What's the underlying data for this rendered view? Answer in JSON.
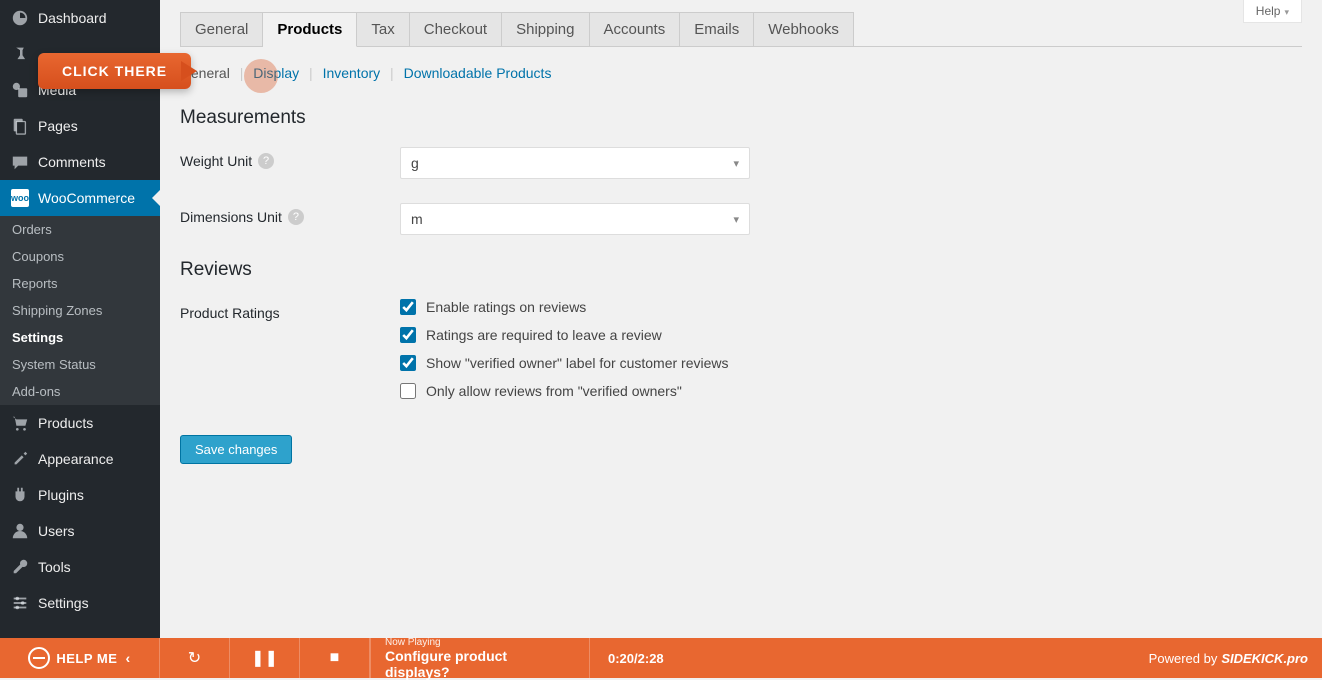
{
  "help_tab": "Help",
  "callout": "CLICK THERE",
  "sidebar": {
    "items": [
      {
        "label": "Dashboard"
      },
      {
        "label": ""
      },
      {
        "label": "Media"
      },
      {
        "label": "Pages"
      },
      {
        "label": "Comments"
      },
      {
        "label": "WooCommerce"
      },
      {
        "label": "Products"
      },
      {
        "label": "Appearance"
      },
      {
        "label": "Plugins"
      },
      {
        "label": "Users"
      },
      {
        "label": "Tools"
      },
      {
        "label": "Settings"
      }
    ],
    "woo_sub": [
      {
        "label": "Orders"
      },
      {
        "label": "Coupons"
      },
      {
        "label": "Reports"
      },
      {
        "label": "Shipping Zones"
      },
      {
        "label": "Settings"
      },
      {
        "label": "System Status"
      },
      {
        "label": "Add-ons"
      }
    ]
  },
  "tabs": [
    {
      "label": "General"
    },
    {
      "label": "Products"
    },
    {
      "label": "Tax"
    },
    {
      "label": "Checkout"
    },
    {
      "label": "Shipping"
    },
    {
      "label": "Accounts"
    },
    {
      "label": "Emails"
    },
    {
      "label": "Webhooks"
    }
  ],
  "subtabs": {
    "general": "General",
    "display": "Display",
    "inventory": "Inventory",
    "downloadable": "Downloadable Products"
  },
  "sections": {
    "measurements": {
      "heading": "Measurements",
      "weight_label": "Weight Unit",
      "weight_value": "g",
      "dimensions_label": "Dimensions Unit",
      "dimensions_value": "m"
    },
    "reviews": {
      "heading": "Reviews",
      "ratings_label": "Product Ratings",
      "opts": [
        {
          "label": "Enable ratings on reviews",
          "checked": true
        },
        {
          "label": "Ratings are required to leave a review",
          "checked": true
        },
        {
          "label": "Show \"verified owner\" label for customer reviews",
          "checked": true
        },
        {
          "label": "Only allow reviews from \"verified owners\"",
          "checked": false
        }
      ]
    }
  },
  "save_button": "Save changes",
  "footer": {
    "helpme": "HELP ME",
    "now_playing_label": "Now Playing",
    "now_playing_title": "Configure product displays?",
    "time": "0:20/2:28",
    "powered": "Powered by",
    "brand": "SIDEKICK.pro"
  }
}
